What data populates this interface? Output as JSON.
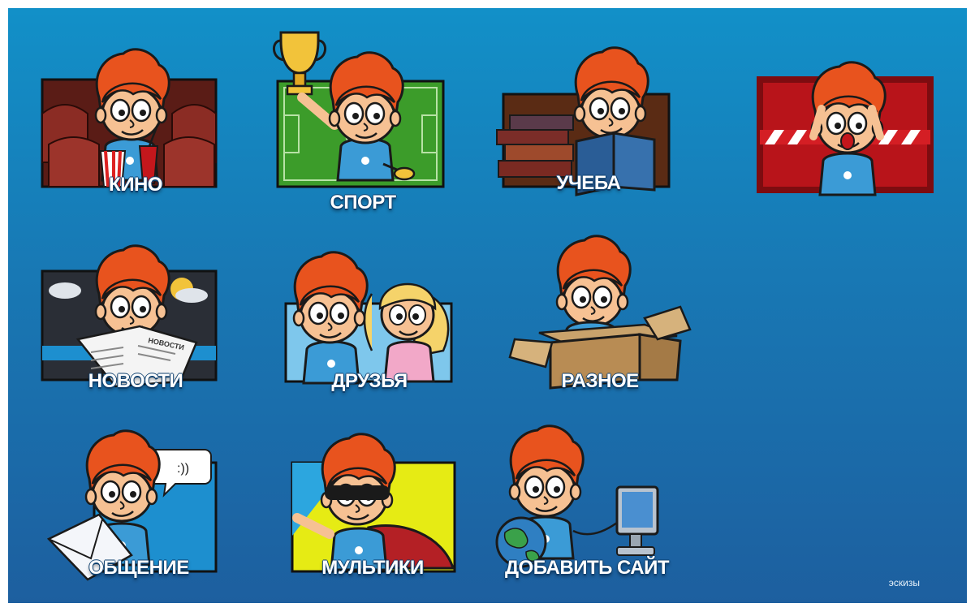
{
  "tiles": [
    {
      "label": "КИНО",
      "icon": "cinema-icon"
    },
    {
      "label": "СПОРТ",
      "icon": "trophy-icon"
    },
    {
      "label": "УЧЕБА",
      "icon": "books-icon"
    },
    {
      "label": "",
      "icon": "clapperboard-icon"
    },
    {
      "label": "НОВОСТИ",
      "icon": "newspaper-icon"
    },
    {
      "label": "ДРУЗЬЯ",
      "icon": "friends-icon"
    },
    {
      "label": "РАЗНОЕ",
      "icon": "box-icon"
    },
    {
      "label": "ОБЩЕНИЕ",
      "icon": "chat-icon"
    },
    {
      "label": "МУЛЬТИКИ",
      "icon": "superhero-icon"
    },
    {
      "label": "ДОБАВИТЬ САЙТ",
      "icon": "add-site-icon"
    }
  ],
  "footer": {
    "thumbnails_label": "эскизы"
  },
  "scene": {
    "chat_bubble_text": ":))",
    "newspaper_text": "НОВОСТИ"
  },
  "colors": {
    "background_top": "#1290c8",
    "background_bottom": "#1d5f9f",
    "hair": "#e8531e",
    "skin": "#f6c193",
    "shirt": "#3b9bd6"
  }
}
